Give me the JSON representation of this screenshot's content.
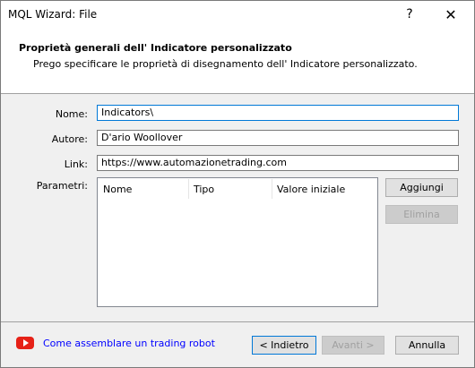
{
  "window": {
    "title": "MQL Wizard: File",
    "help_glyph": "?",
    "close_glyph": "✕"
  },
  "header": {
    "title": "Proprietà generali dell' Indicatore personalizzato",
    "subtitle": "Prego specificare le proprietà di disegnamento dell' Indicatore personalizzato."
  },
  "form": {
    "name_label": "Nome:",
    "name_value": "Indicators\\",
    "author_label": "Autore:",
    "author_value": "D'ario Woollover",
    "link_label": "Link:",
    "link_value": "https://www.automazionetrading.com",
    "params_label": "Parametri:"
  },
  "params_table": {
    "columns": [
      "Nome",
      "Tipo",
      "Valore iniziale"
    ]
  },
  "side_buttons": {
    "add": "Aggiungi",
    "delete": "Elimina"
  },
  "footer": {
    "link_text": "Come assemblare un trading robot",
    "back": "< Indietro",
    "next": "Avanti >",
    "cancel": "Annulla"
  }
}
